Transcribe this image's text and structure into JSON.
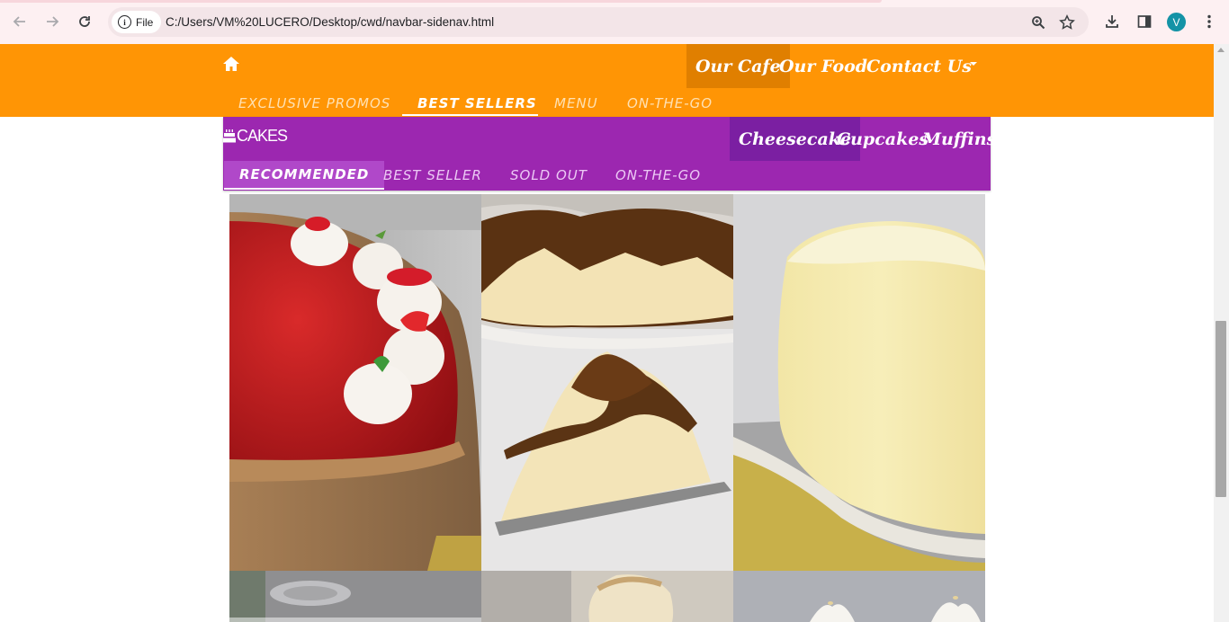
{
  "browser": {
    "back_icon": "arrow-left-icon",
    "forward_icon": "arrow-right-icon",
    "reload_icon": "reload-icon",
    "file_chip_label": "File",
    "url": "C:/Users/VM%20LUCERO/Desktop/cwd/navbar-sidenav.html",
    "profile_initial": "V"
  },
  "topnav": {
    "bg_color": "#ff9505",
    "menu": [
      "Our Cafe",
      "Our Food",
      "Contact Us"
    ],
    "active_menu": "Our Cafe",
    "submenu": [
      "EXCLUSIVE PROMOS",
      "BEST SELLERS",
      "MENU",
      "ON-THE-GO"
    ],
    "active_submenu": "BEST SELLERS"
  },
  "cakesbar": {
    "bg_color": "#9c27b0",
    "brand": "CAKES",
    "menu": [
      "Cheesecake",
      "Cupcakes",
      "Muffins"
    ],
    "active_menu": "Cheesecake",
    "submenu": [
      "RECOMMENDED",
      "BEST SELLER",
      "SOLD OUT",
      "ON-THE-GO"
    ],
    "active_submenu": "RECOMMENDED"
  },
  "gallery": {
    "items": [
      "strawberry-cheesecake-photo",
      "basque-burnt-cheesecake-photo",
      "japanese-cotton-cheesecake-photo",
      "cake-photo-row2-1",
      "cake-photo-row2-2",
      "cake-photo-row2-3"
    ]
  }
}
